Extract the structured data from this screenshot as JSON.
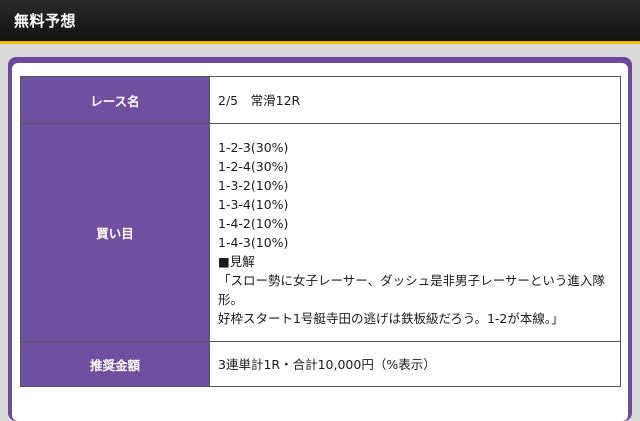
{
  "header": {
    "title": "無料予想"
  },
  "table": {
    "race_label": "レース名",
    "race_value": "2/5　常滑12R",
    "bets_label": "買い目",
    "bets": [
      "1-2-3(30%)",
      "1-2-4(30%)",
      "1-3-2(10%)",
      "1-3-4(10%)",
      "1-4-2(10%)",
      "1-4-3(10%)"
    ],
    "view_heading": "■見解",
    "view_text_1": "「スロー勢に女子レーサー、ダッシュ是非男子レーサーという進入隊形。",
    "view_text_2": "好枠スタート1号艇寺田の逃げは鉄板級だろう。1-2が本線。」",
    "amount_label": "推奨金額",
    "amount_value": "3連単計1R・合計10,000円（%表示）"
  },
  "colors": {
    "header_bg": "#1a1a1a",
    "header_accent": "#f0c200",
    "label_bg": "#6f4fa0",
    "panel_border": "#6b4a9a"
  }
}
